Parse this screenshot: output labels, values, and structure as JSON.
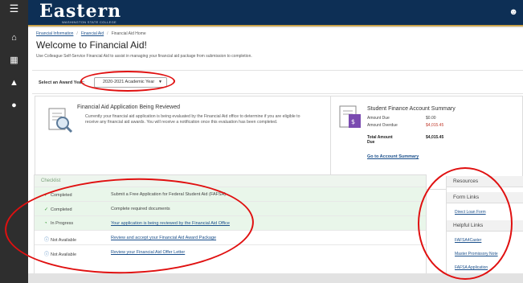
{
  "app": {
    "logo_text": "Eastern",
    "logo_subtext": "WASHINGTON STATE COLLEGE",
    "colors": {
      "topbar": "#0d2f55",
      "sidebar": "#2e2e2e",
      "accent": "#c8a24a",
      "link": "#1a4f8b",
      "annotation": "#e01010"
    }
  },
  "sidebar": {
    "icons": [
      "menu-icon",
      "home-icon",
      "bank-icon",
      "graduation-cap-icon",
      "dollar-icon"
    ]
  },
  "header": {
    "user_icon": "user-icon"
  },
  "breadcrumb": {
    "items": [
      "Financial Information",
      "Financial Aid",
      "Financial Aid Home"
    ]
  },
  "page": {
    "title": "Welcome to Financial Aid!",
    "description": "Use Colleague Self-Service Financial Aid to assist in managing your financial aid package from submission to completion."
  },
  "award_year": {
    "label": "Select an Award Year:",
    "selected": "2020-2021 Academic Year"
  },
  "review_panel": {
    "title": "Financial Aid Application Being Reviewed",
    "text": "Currently your financial aid application is being evaluated by the Financial Aid office to determine if you are eligible to receive any financial aid awards. You will receive a notification once this evaluation has been completed."
  },
  "finance_panel": {
    "title": "Student Finance Account Summary",
    "amount_due_label": "Amount Due",
    "amount_due_value": "$0.00",
    "amount_overdue_label": "Amount Overdue",
    "amount_overdue_value": "$4,015.45",
    "total_label": "Total Amount Due",
    "total_value": "$4,015.45",
    "link": "Go to Account Summary"
  },
  "checklist": {
    "header": "Checklist",
    "items": [
      {
        "status": "Completed",
        "task": "Submit a Free Application for Federal Student Aid (FAFSA)",
        "icon": "check-icon"
      },
      {
        "status": "Completed",
        "task": "Complete required documents",
        "icon": "check-icon"
      },
      {
        "status": "In Progress",
        "task": "Your application is being reviewed by the Financial Aid Office",
        "icon": "progress-icon"
      },
      {
        "status": "Not Available",
        "task": "Review and accept your Financial Aid Award Package",
        "icon": "info-icon"
      },
      {
        "status": "Not Available",
        "task": "Review your Financial Aid Offer Letter",
        "icon": "info-icon"
      }
    ]
  },
  "resources": {
    "header": "Resources",
    "form_links_header": "Form Links",
    "form_links": [
      "Direct Loan Form"
    ],
    "helpful_links_header": "Helpful Links",
    "helpful_links": [
      "FAFSA4Caster",
      "Master Promissory Note",
      "FAFSA Application"
    ]
  }
}
